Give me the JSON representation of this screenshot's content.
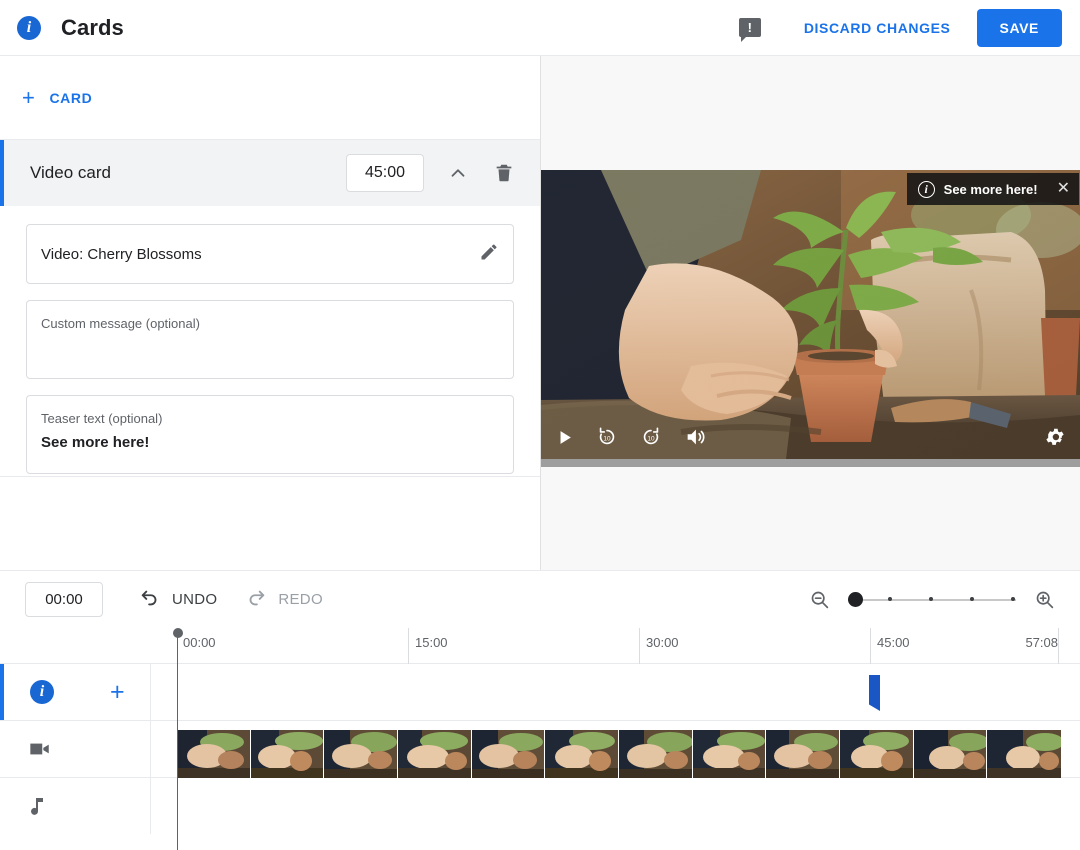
{
  "header": {
    "info_icon": "info-icon",
    "title": "Cards",
    "feedback_icon": "feedback-icon",
    "feedback_glyph": "!",
    "discard_label": "DISCARD CHANGES",
    "save_label": "SAVE",
    "accent_color": "#1a73e8"
  },
  "left_panel": {
    "add_card": {
      "plus": "+",
      "label": "CARD"
    },
    "card": {
      "title": "Video card",
      "time": "45:00",
      "collapse_icon": "chevron-up-icon",
      "delete_icon": "trash-icon",
      "video_field": {
        "value": "Video: Cherry Blossoms",
        "edit_icon": "pencil-icon"
      },
      "custom_message": {
        "label": "Custom message (optional)",
        "value": ""
      },
      "teaser": {
        "label": "Teaser text (optional)",
        "value": "See more here!"
      }
    }
  },
  "preview": {
    "overlay": {
      "info_icon": "info-circle-icon",
      "text": "See more here!",
      "close_icon": "close-icon"
    },
    "controls": [
      {
        "name": "play-icon",
        "label": "Play"
      },
      {
        "name": "replay-10-icon",
        "label": "10"
      },
      {
        "name": "forward-10-icon",
        "label": "10"
      },
      {
        "name": "volume-icon",
        "label": "Volume"
      }
    ],
    "settings_icon": "gear-icon"
  },
  "timeline_toolbar": {
    "timecode": "00:00",
    "undo": {
      "icon": "undo-icon",
      "label": "UNDO",
      "enabled": true
    },
    "redo": {
      "icon": "redo-icon",
      "label": "REDO",
      "enabled": false
    },
    "zoom_out_icon": "zoom-out-icon",
    "zoom_in_icon": "zoom-in-icon",
    "zoom_level": 0
  },
  "timeline": {
    "ruler_marks": [
      "00:00",
      "15:00",
      "30:00",
      "45:00"
    ],
    "duration_label": "57:08",
    "playhead_time": "00:00",
    "tracks": [
      {
        "name": "cards-track",
        "icon": "info-icon",
        "add_icon": "plus-icon"
      },
      {
        "name": "video-track",
        "icon": "video-camera-icon"
      },
      {
        "name": "audio-track",
        "icon": "music-note-icon"
      }
    ],
    "card_marker_time": "45:00"
  }
}
